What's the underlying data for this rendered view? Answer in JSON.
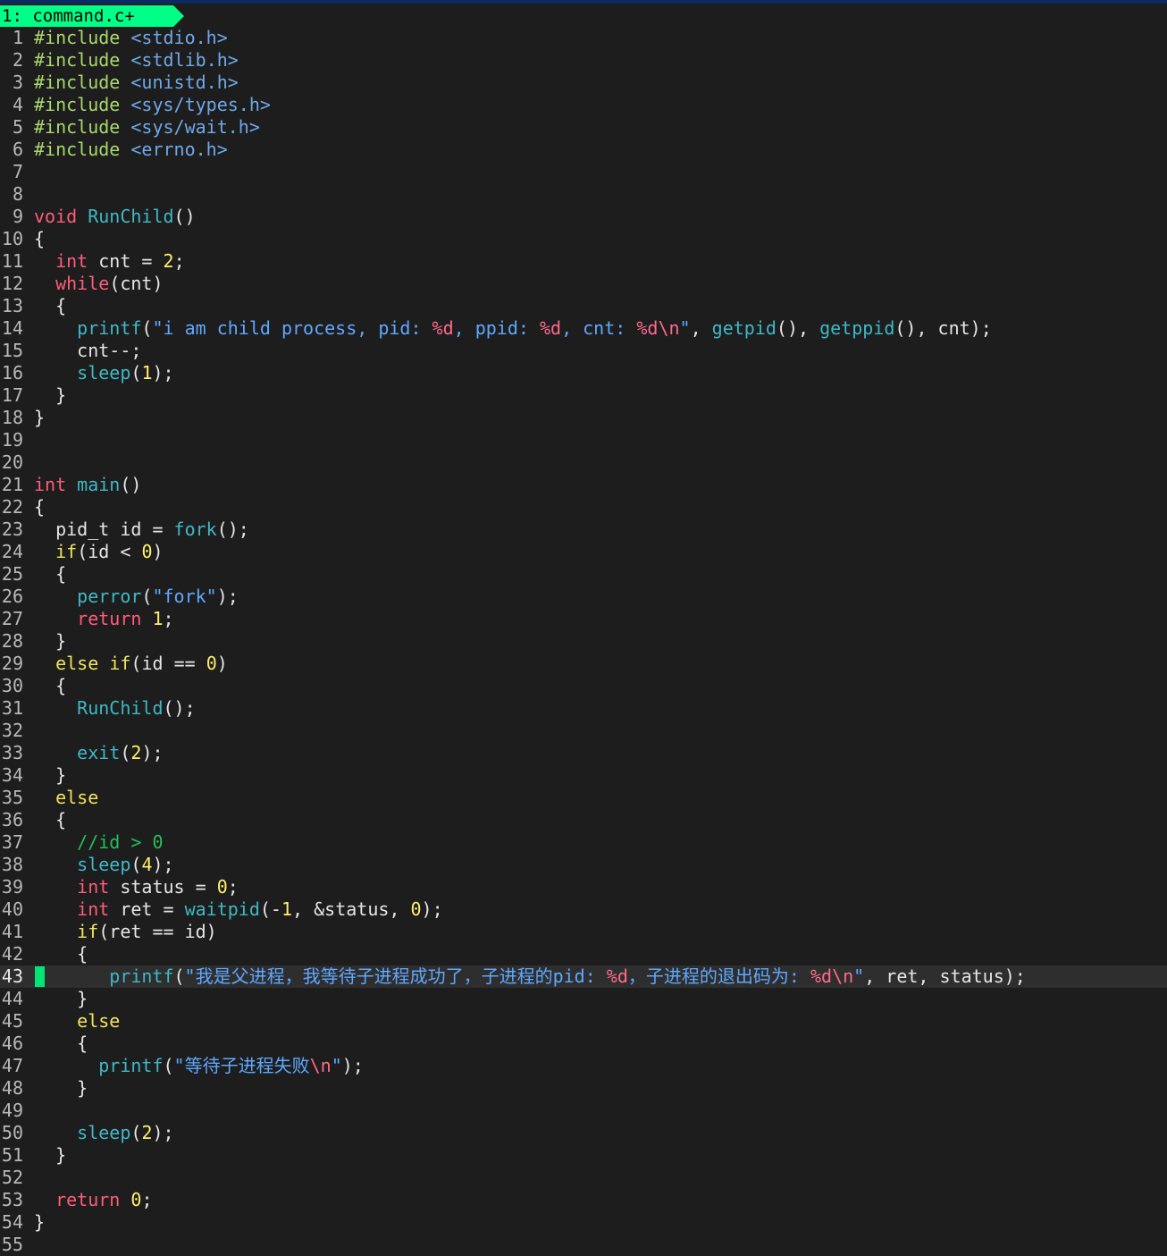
{
  "tab": {
    "label": "1: command.c+"
  },
  "colors": {
    "tab_bg": "#00ff87",
    "cursor": "#00e676",
    "background": "#1d1d1d"
  },
  "editor": {
    "current_line": 43,
    "lines": [
      [
        [
          "pp",
          "#include "
        ],
        [
          "hdr",
          "<stdio.h>"
        ]
      ],
      [
        [
          "pp",
          "#include "
        ],
        [
          "hdr",
          "<stdlib.h>"
        ]
      ],
      [
        [
          "pp",
          "#include "
        ],
        [
          "hdr",
          "<unistd.h>"
        ]
      ],
      [
        [
          "pp",
          "#include "
        ],
        [
          "hdr",
          "<sys/types.h>"
        ]
      ],
      [
        [
          "pp",
          "#include "
        ],
        [
          "hdr",
          "<sys/wait.h>"
        ]
      ],
      [
        [
          "pp",
          "#include "
        ],
        [
          "hdr",
          "<errno.h>"
        ]
      ],
      [],
      [],
      [
        [
          "kw",
          "void"
        ],
        [
          "txt",
          " "
        ],
        [
          "fn",
          "RunChild"
        ],
        [
          "txt",
          "()"
        ]
      ],
      [
        [
          "txt",
          "{"
        ]
      ],
      [
        [
          "txt",
          "  "
        ],
        [
          "kw",
          "int"
        ],
        [
          "txt",
          " cnt = "
        ],
        [
          "num",
          "2"
        ],
        [
          "txt",
          ";"
        ]
      ],
      [
        [
          "txt",
          "  "
        ],
        [
          "kw",
          "while"
        ],
        [
          "txt",
          "(cnt)"
        ]
      ],
      [
        [
          "txt",
          "  {"
        ]
      ],
      [
        [
          "txt",
          "    "
        ],
        [
          "fn",
          "printf"
        ],
        [
          "txt",
          "("
        ],
        [
          "str",
          "\"i am child process, pid: "
        ],
        [
          "esc",
          "%d"
        ],
        [
          "str",
          ", ppid: "
        ],
        [
          "esc",
          "%d"
        ],
        [
          "str",
          ", cnt: "
        ],
        [
          "esc",
          "%d\\n"
        ],
        [
          "str",
          "\""
        ],
        [
          "txt",
          ", "
        ],
        [
          "fn",
          "getpid"
        ],
        [
          "txt",
          "(), "
        ],
        [
          "fn",
          "getppid"
        ],
        [
          "txt",
          "(), cnt);"
        ]
      ],
      [
        [
          "txt",
          "    cnt--;"
        ]
      ],
      [
        [
          "txt",
          "    "
        ],
        [
          "fn",
          "sleep"
        ],
        [
          "txt",
          "("
        ],
        [
          "num",
          "1"
        ],
        [
          "txt",
          ");"
        ]
      ],
      [
        [
          "txt",
          "  }"
        ]
      ],
      [
        [
          "txt",
          "}"
        ]
      ],
      [],
      [],
      [
        [
          "kw",
          "int"
        ],
        [
          "txt",
          " "
        ],
        [
          "fn",
          "main"
        ],
        [
          "txt",
          "()"
        ]
      ],
      [
        [
          "txt",
          "{"
        ]
      ],
      [
        [
          "txt",
          "  pid_t id = "
        ],
        [
          "fn",
          "fork"
        ],
        [
          "txt",
          "();"
        ]
      ],
      [
        [
          "txt",
          "  "
        ],
        [
          "kw2",
          "if"
        ],
        [
          "txt",
          "(id < "
        ],
        [
          "num",
          "0"
        ],
        [
          "txt",
          ")"
        ]
      ],
      [
        [
          "txt",
          "  {"
        ]
      ],
      [
        [
          "txt",
          "    "
        ],
        [
          "fn",
          "perror"
        ],
        [
          "txt",
          "("
        ],
        [
          "str",
          "\"fork\""
        ],
        [
          "txt",
          ");"
        ]
      ],
      [
        [
          "txt",
          "    "
        ],
        [
          "kw",
          "return"
        ],
        [
          "txt",
          " "
        ],
        [
          "num",
          "1"
        ],
        [
          "txt",
          ";"
        ]
      ],
      [
        [
          "txt",
          "  }"
        ]
      ],
      [
        [
          "txt",
          "  "
        ],
        [
          "kw2",
          "else"
        ],
        [
          "txt",
          " "
        ],
        [
          "kw2",
          "if"
        ],
        [
          "txt",
          "(id == "
        ],
        [
          "num",
          "0"
        ],
        [
          "txt",
          ")"
        ]
      ],
      [
        [
          "txt",
          "  {"
        ]
      ],
      [
        [
          "txt",
          "    "
        ],
        [
          "fn",
          "RunChild"
        ],
        [
          "txt",
          "();"
        ]
      ],
      [],
      [
        [
          "txt",
          "    "
        ],
        [
          "fn",
          "exit"
        ],
        [
          "txt",
          "("
        ],
        [
          "num",
          "2"
        ],
        [
          "txt",
          ");"
        ]
      ],
      [
        [
          "txt",
          "  }"
        ]
      ],
      [
        [
          "txt",
          "  "
        ],
        [
          "kw2",
          "else"
        ]
      ],
      [
        [
          "txt",
          "  {"
        ]
      ],
      [
        [
          "txt",
          "    "
        ],
        [
          "cmt",
          "//id > 0"
        ]
      ],
      [
        [
          "txt",
          "    "
        ],
        [
          "fn",
          "sleep"
        ],
        [
          "txt",
          "("
        ],
        [
          "num",
          "4"
        ],
        [
          "txt",
          ");"
        ]
      ],
      [
        [
          "txt",
          "    "
        ],
        [
          "kw",
          "int"
        ],
        [
          "txt",
          " status = "
        ],
        [
          "num",
          "0"
        ],
        [
          "txt",
          ";"
        ]
      ],
      [
        [
          "txt",
          "    "
        ],
        [
          "kw",
          "int"
        ],
        [
          "txt",
          " ret = "
        ],
        [
          "fn",
          "waitpid"
        ],
        [
          "txt",
          "(-"
        ],
        [
          "num",
          "1"
        ],
        [
          "txt",
          ", &status, "
        ],
        [
          "num",
          "0"
        ],
        [
          "txt",
          ");"
        ]
      ],
      [
        [
          "txt",
          "    "
        ],
        [
          "kw2",
          "if"
        ],
        [
          "txt",
          "(ret == id)"
        ]
      ],
      [
        [
          "txt",
          "    {"
        ]
      ],
      [
        [
          "txt",
          "      "
        ],
        [
          "fn",
          "printf"
        ],
        [
          "txt",
          "("
        ],
        [
          "str",
          "\"我是父进程，我等待子进程成功了，子进程的pid: "
        ],
        [
          "esc",
          "%d"
        ],
        [
          "str",
          "，子进程的退出码为: "
        ],
        [
          "esc",
          "%d\\n"
        ],
        [
          "str",
          "\""
        ],
        [
          "txt",
          ", ret, status);"
        ]
      ],
      [
        [
          "txt",
          "    }"
        ]
      ],
      [
        [
          "txt",
          "    "
        ],
        [
          "kw2",
          "else"
        ]
      ],
      [
        [
          "txt",
          "    {"
        ]
      ],
      [
        [
          "txt",
          "      "
        ],
        [
          "fn",
          "printf"
        ],
        [
          "txt",
          "("
        ],
        [
          "str",
          "\"等待子进程失败"
        ],
        [
          "esc",
          "\\n"
        ],
        [
          "str",
          "\""
        ],
        [
          "txt",
          ");"
        ]
      ],
      [
        [
          "txt",
          "    }"
        ]
      ],
      [],
      [
        [
          "txt",
          "    "
        ],
        [
          "fn",
          "sleep"
        ],
        [
          "txt",
          "("
        ],
        [
          "num",
          "2"
        ],
        [
          "txt",
          ");"
        ]
      ],
      [
        [
          "txt",
          "  }"
        ]
      ],
      [],
      [
        [
          "txt",
          "  "
        ],
        [
          "kw",
          "return"
        ],
        [
          "txt",
          " "
        ],
        [
          "num",
          "0"
        ],
        [
          "txt",
          ";"
        ]
      ],
      [
        [
          "txt",
          "}"
        ]
      ],
      []
    ]
  }
}
